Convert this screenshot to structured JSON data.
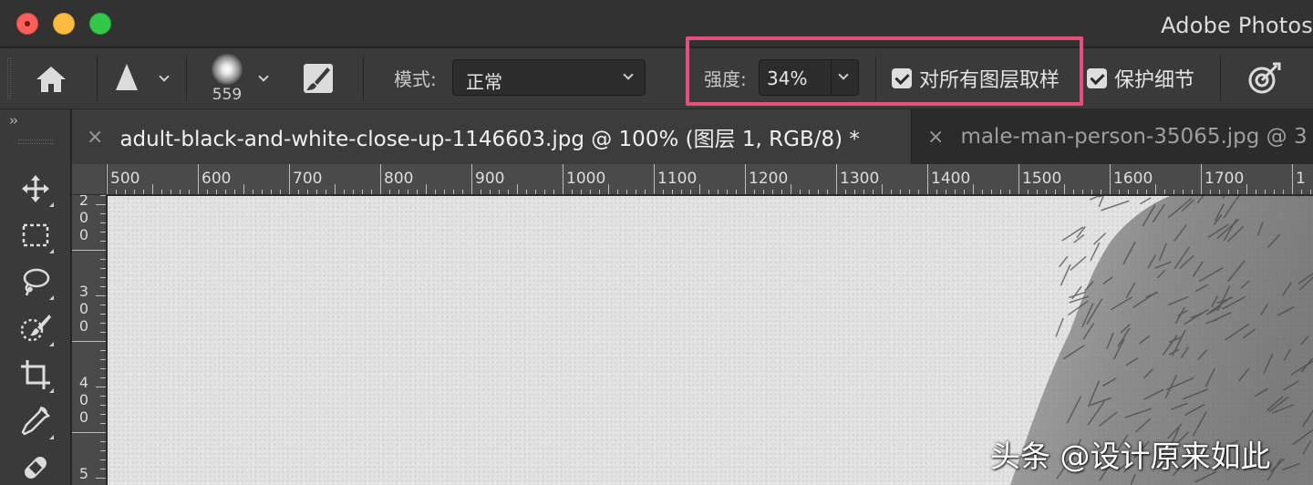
{
  "window": {
    "app_title": "Adobe Photos"
  },
  "options_bar": {
    "brush_size": "559",
    "mode_label": "模式:",
    "mode_value": "正常",
    "strength_label": "强度:",
    "strength_value": "34%",
    "sample_all_layers_label": "对所有图层取样",
    "sample_all_layers_checked": true,
    "protect_detail_label": "保护细节",
    "protect_detail_checked": true,
    "highlight_color": "#e94f7e"
  },
  "tabs": [
    {
      "close": "×",
      "name": "adult-black-and-white-close-up-1146603.jpg @ 100% (图层 1, RGB/8) *",
      "active": true
    },
    {
      "close": "×",
      "name": "male-man-person-35065.jpg @ 3",
      "active": false
    }
  ],
  "toolbar": {
    "collapse": "››",
    "tools": [
      "move-tool",
      "rectangular-marquee-tool",
      "lasso-tool",
      "quick-selection-tool",
      "crop-tool",
      "eyedropper-tool",
      "healing-brush-tool"
    ]
  },
  "rulers": {
    "horizontal": [
      "500",
      "600",
      "700",
      "800",
      "900",
      "1000",
      "1100",
      "1200",
      "1300",
      "1400",
      "1500",
      "1600",
      "1700",
      "1"
    ],
    "vertical": [
      [
        "2",
        "0",
        "0"
      ],
      [
        "3",
        "0",
        "0"
      ],
      [
        "4",
        "0",
        "0"
      ],
      [
        "5"
      ]
    ]
  },
  "canvas": {
    "watermark": "头条 @设计原来如此"
  }
}
